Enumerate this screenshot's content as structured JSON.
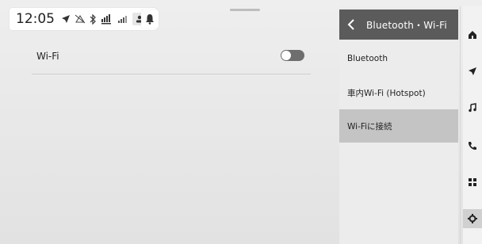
{
  "status_bar": {
    "time": "12:05",
    "icons": [
      "navigation-arrow-icon",
      "no-signal-icon",
      "bluetooth-icon",
      "cellular-signal-dcm-icon",
      "cellular-signal-icon",
      "user-icon"
    ]
  },
  "main": {
    "rows": [
      {
        "label": "Wi-Fi",
        "toggle_on": false
      }
    ]
  },
  "panel": {
    "title": "Bluetooth・Wi-Fi",
    "items": [
      {
        "label": "Bluetooth",
        "selected": false
      },
      {
        "label": "車内Wi-Fi (Hotspot)",
        "selected": false
      },
      {
        "label": "Wi-Fiに接続",
        "selected": true
      }
    ]
  },
  "rail": {
    "icons": [
      "home-icon",
      "navigation-icon",
      "music-icon",
      "phone-icon",
      "apps-grid-icon",
      "settings-gear-icon"
    ],
    "active": "settings-gear-icon"
  },
  "colors": {
    "header_bg": "#5b5b5b",
    "selected_item_bg": "#c4c4c4",
    "toggle_off": "#6e6e6e"
  }
}
